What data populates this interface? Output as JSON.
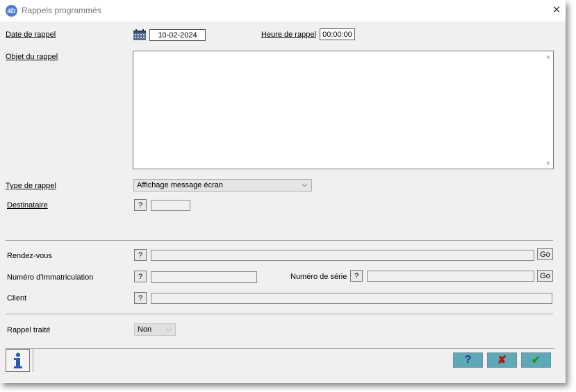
{
  "window": {
    "title": "Rappels programmés",
    "app_icon_text": "4D"
  },
  "form": {
    "date_label": "Date de rappel",
    "date_value": "10-02-2024",
    "time_label": "Heure de rappel",
    "time_value": "00:00:00",
    "subject_label": "Objet du rappel",
    "subject_value": "",
    "type_label": "Type de rappel",
    "type_value": "Affichage message écran",
    "recipient_label": "Destinataire",
    "recipient_value": "",
    "appointment_label": "Rendez-vous",
    "appointment_value": "",
    "registration_label": "Numéro d'immatriculation",
    "registration_value": "",
    "serial_label": "Numéro de série",
    "serial_value": "",
    "client_label": "Client",
    "client_value": "",
    "processed_label": "Rappel traité",
    "processed_value": "Non",
    "help_q": "?",
    "go_label": "Go"
  },
  "footer": {
    "info_icon": "info-icon",
    "help_symbol": "?",
    "cancel_symbol": "✘",
    "ok_symbol": "✔"
  },
  "colors": {
    "footer_buttons": "#5fa8b8",
    "cancel_x": "#b01818",
    "ok_check": "#1a9a1a",
    "icon_blue": "#2a5ab0"
  }
}
